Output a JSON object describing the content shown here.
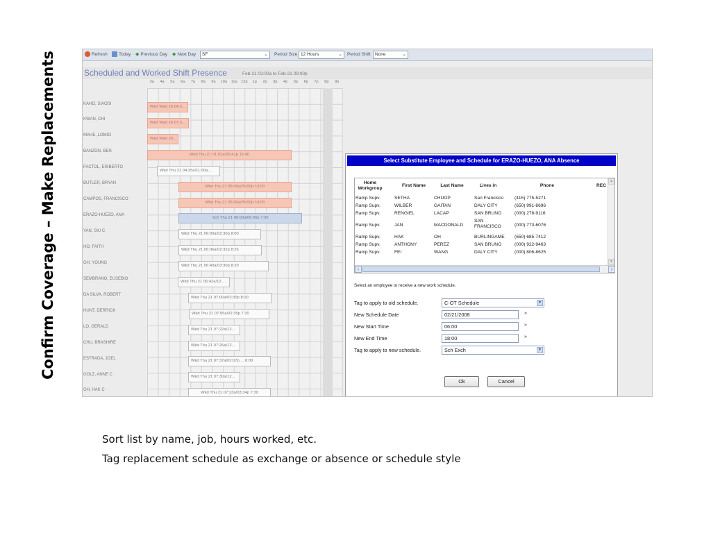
{
  "slide": {
    "title": "Confirm Coverage – Make Replacements",
    "bullets": [
      "Sort list by name, job, hours worked, etc.",
      "Tag replacement schedule as exchange or absence or schedule style"
    ]
  },
  "toolbar": {
    "refresh": "Refresh",
    "refresh_icon": "refresh-icon",
    "today": "Today",
    "today_icon": "calendar-icon",
    "previous_day": "Previous Day",
    "next_day": "Next Day",
    "location_value": "SF",
    "period_size_label": "Period Size",
    "period_size_value": "12 Hours",
    "period_shift_label": "Period Shift",
    "period_shift_value": "None"
  },
  "schedule": {
    "title": "Scheduled and Worked Shift Presence",
    "range": "Feb-21 03:00a to Feb-21 09:00p",
    "hours": [
      "3a",
      "4a",
      "5a",
      "6a",
      "7a",
      "8a",
      "9a",
      "10a",
      "11a",
      "12p",
      "1p",
      "2p",
      "3p",
      "4p",
      "5p",
      "6p",
      "7p",
      "8p",
      "9p"
    ],
    "employees": [
      "KAHO, SIAOSI",
      "KWAN, CHI",
      "MAHE, LOMIO",
      "BANZON, BEN",
      "FACTOL, ERIBERTO",
      "BUTLER, BRYAN",
      "CAMPOS, FRANCISCO",
      "ERAZO-HUEZO, ANA",
      "YAN, SIU C",
      "HO, FAITH",
      "OH, YOUNG",
      "SEMBRANO, EUSEBIO",
      "DA SILVA, ROBERT",
      "HUNT, DERRICK",
      "LO, GERALD",
      "CHU, BRASHIRE",
      "ESTRADA, JOEL",
      "GOLZ, ANNE C",
      "OH, HAK C"
    ],
    "bars": [
      "Wkd Wed 20 04:3...",
      "Wkd Wed 20 07:3...",
      "Wkd Wed 20...",
      "Wkd Thu 21 01:01a/05:41p 16:40",
      "Wkd Thu 21 04:25a/11:00a...",
      "Wkd Thu 21 06:00a/05:00p 10:00",
      "Wkd Thu 21 06:00a/05:00p 10:00",
      "Sch Thu 21 06:00a/06:00p 7:30",
      "Wkd Thu 21 06:00a/02:30p 8:00",
      "Wkd Thu 21 06:06a/02:32p 8:26",
      "Wkd Thu 21 06:40a/03:30p 8:20",
      "Wkd Thu 21 06:42a/12...",
      "Wkd Thu 21 07:00a/03:30p 8:00",
      "Wkd Thu 21 07:05a/02:35p 7:30",
      "Wkd Thu 21 07:22a/12...",
      "Wkd Thu 21 07:26a/12...",
      "Wkd Thu 21 07:37a/02:07p ... 6:00",
      "Wkd Thu 21 07:30a/12...",
      "Wkd Thu 21 07:23a/03:34p 7:30"
    ]
  },
  "dialog": {
    "title": "Select Substitute Employee and Schedule for ERAZO-HUEZO, ANA Absence",
    "columns": [
      "Home Workgroup",
      "First Name",
      "Last Name",
      "Lives in",
      "Phone",
      "REC"
    ],
    "rows": [
      [
        "Ramp Supv.",
        "SETHA",
        "CHUOP",
        "San Francisco",
        "(415) 775-5271"
      ],
      [
        "Ramp Supv.",
        "WILBER",
        "GAITAN",
        "DALY CITY",
        "(650) 991-8696"
      ],
      [
        "Ramp Supv.",
        "RENGIEL",
        "LACAP",
        "SAN BRUNO",
        "(000) 278-9116"
      ],
      [
        "Ramp Supv.",
        "JAN",
        "MACDONALD",
        "SAN FRANCISCO",
        "(000) 773-6076"
      ],
      [
        "Ramp Supv.",
        "HAK",
        "OH",
        "BURLINGAME",
        "(650) 685-7412"
      ],
      [
        "Ramp Supv.",
        "ANTHONY",
        "PEREZ",
        "SAN BRUNO",
        "(000) 922-9463"
      ],
      [
        "Ramp Supv.",
        "FEI",
        "WANG",
        "DALY CITY",
        "(000) 806-8625"
      ]
    ],
    "hint": "Select an employee to receive a new work schedule.",
    "form": {
      "old_tag_label": "Tag to apply to old schedule.",
      "old_tag_value": "C-OT Schedule",
      "new_date_label": "New Schedule Date",
      "new_date_value": "02/21/2008",
      "start_label": "New Start Time",
      "start_value": "06:00",
      "end_label": "New End Time",
      "end_value": "18:00",
      "new_tag_label": "Tag to apply to new schedule.",
      "new_tag_value": "Sch Exch"
    },
    "ok": "Ok",
    "cancel": "Cancel"
  }
}
